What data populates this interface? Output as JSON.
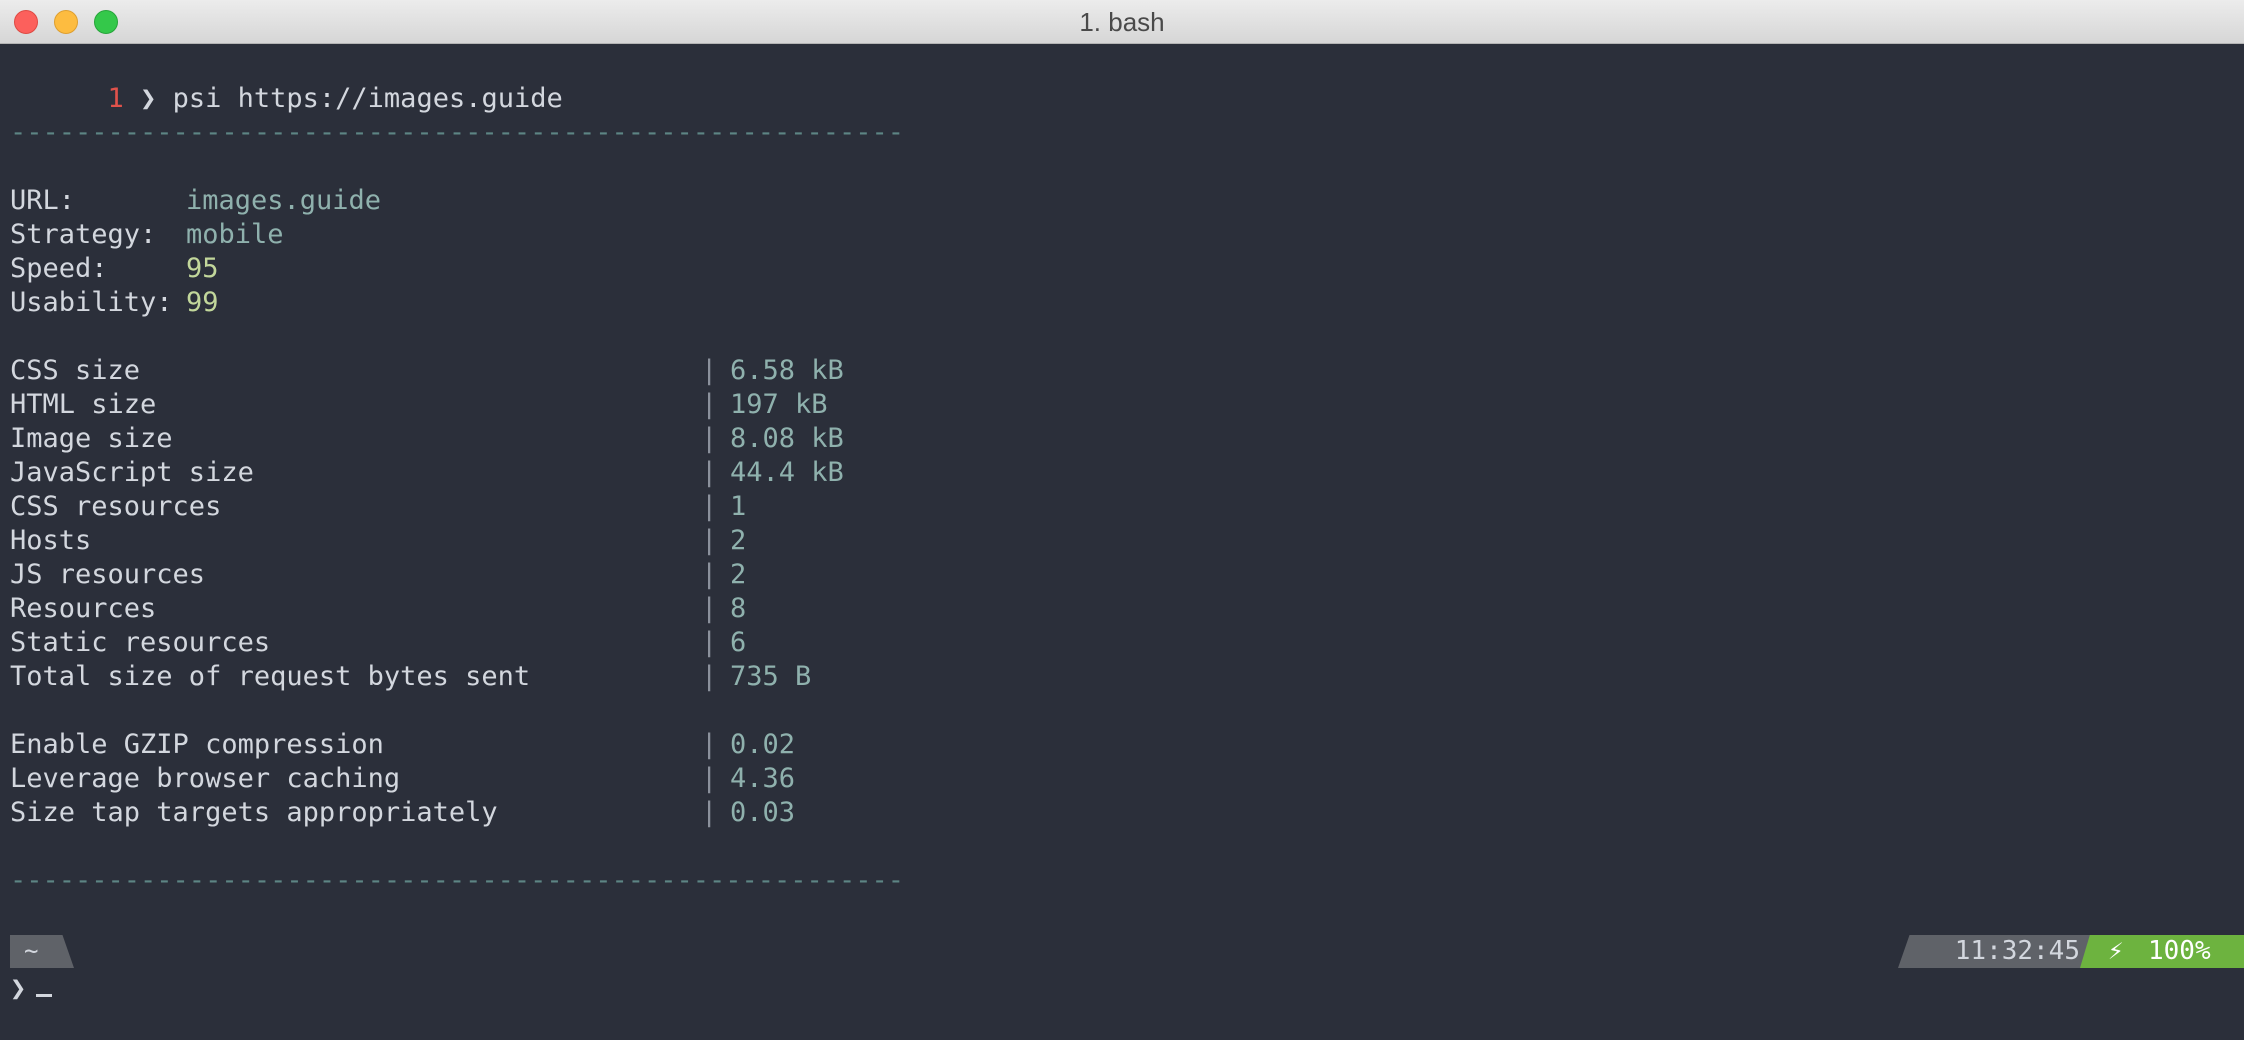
{
  "window": {
    "title": "1. bash"
  },
  "prompt": {
    "number": "1",
    "arrow": "❯",
    "command": "psi https://images.guide"
  },
  "separator": "-------------------------------------------------------",
  "summary": [
    {
      "key": "URL:",
      "value": "images.guide"
    },
    {
      "key": "Strategy:",
      "value": "mobile"
    },
    {
      "key": "Speed:",
      "value": "95"
    },
    {
      "key": "Usability:",
      "value": "99"
    }
  ],
  "stats": [
    {
      "label": "CSS size",
      "value": "6.58 kB"
    },
    {
      "label": "HTML size",
      "value": "197 kB"
    },
    {
      "label": "Image size",
      "value": "8.08 kB"
    },
    {
      "label": "JavaScript size",
      "value": "44.4 kB"
    },
    {
      "label": "CSS resources",
      "value": "1"
    },
    {
      "label": "Hosts",
      "value": "2"
    },
    {
      "label": "JS resources",
      "value": "2"
    },
    {
      "label": "Resources",
      "value": "8"
    },
    {
      "label": "Static resources",
      "value": "6"
    },
    {
      "label": "Total size of request bytes sent",
      "value": "735 B"
    }
  ],
  "rules": [
    {
      "label": "Enable GZIP compression",
      "value": "0.02"
    },
    {
      "label": "Leverage browser caching",
      "value": "4.36"
    },
    {
      "label": "Size tap targets appropriately",
      "value": "0.03"
    }
  ],
  "pipe": "|",
  "statusbar": {
    "cwd": "~",
    "time": "11:32:45",
    "battery_icon": "⚡",
    "battery": "100%"
  },
  "prompt2": {
    "arrow": "❯"
  },
  "colors": {
    "background": "#2b2f3a",
    "battery_segment": "#6db33f",
    "prompt_number": "#e0524b"
  }
}
